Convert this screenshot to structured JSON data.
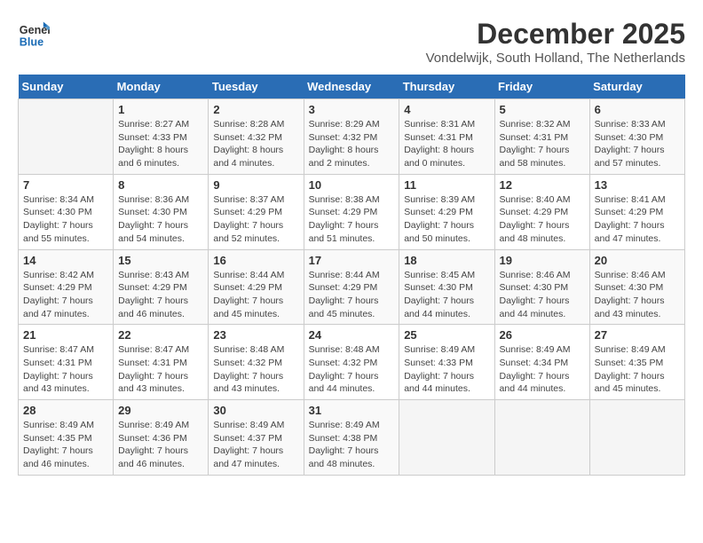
{
  "header": {
    "logo_line1": "General",
    "logo_line2": "Blue",
    "title": "December 2025",
    "subtitle": "Vondelwijk, South Holland, The Netherlands"
  },
  "calendar": {
    "weekdays": [
      "Sunday",
      "Monday",
      "Tuesday",
      "Wednesday",
      "Thursday",
      "Friday",
      "Saturday"
    ],
    "weeks": [
      [
        {
          "day": "",
          "info": ""
        },
        {
          "day": "1",
          "info": "Sunrise: 8:27 AM\nSunset: 4:33 PM\nDaylight: 8 hours\nand 6 minutes."
        },
        {
          "day": "2",
          "info": "Sunrise: 8:28 AM\nSunset: 4:32 PM\nDaylight: 8 hours\nand 4 minutes."
        },
        {
          "day": "3",
          "info": "Sunrise: 8:29 AM\nSunset: 4:32 PM\nDaylight: 8 hours\nand 2 minutes."
        },
        {
          "day": "4",
          "info": "Sunrise: 8:31 AM\nSunset: 4:31 PM\nDaylight: 8 hours\nand 0 minutes."
        },
        {
          "day": "5",
          "info": "Sunrise: 8:32 AM\nSunset: 4:31 PM\nDaylight: 7 hours\nand 58 minutes."
        },
        {
          "day": "6",
          "info": "Sunrise: 8:33 AM\nSunset: 4:30 PM\nDaylight: 7 hours\nand 57 minutes."
        }
      ],
      [
        {
          "day": "7",
          "info": "Sunrise: 8:34 AM\nSunset: 4:30 PM\nDaylight: 7 hours\nand 55 minutes."
        },
        {
          "day": "8",
          "info": "Sunrise: 8:36 AM\nSunset: 4:30 PM\nDaylight: 7 hours\nand 54 minutes."
        },
        {
          "day": "9",
          "info": "Sunrise: 8:37 AM\nSunset: 4:29 PM\nDaylight: 7 hours\nand 52 minutes."
        },
        {
          "day": "10",
          "info": "Sunrise: 8:38 AM\nSunset: 4:29 PM\nDaylight: 7 hours\nand 51 minutes."
        },
        {
          "day": "11",
          "info": "Sunrise: 8:39 AM\nSunset: 4:29 PM\nDaylight: 7 hours\nand 50 minutes."
        },
        {
          "day": "12",
          "info": "Sunrise: 8:40 AM\nSunset: 4:29 PM\nDaylight: 7 hours\nand 48 minutes."
        },
        {
          "day": "13",
          "info": "Sunrise: 8:41 AM\nSunset: 4:29 PM\nDaylight: 7 hours\nand 47 minutes."
        }
      ],
      [
        {
          "day": "14",
          "info": "Sunrise: 8:42 AM\nSunset: 4:29 PM\nDaylight: 7 hours\nand 47 minutes."
        },
        {
          "day": "15",
          "info": "Sunrise: 8:43 AM\nSunset: 4:29 PM\nDaylight: 7 hours\nand 46 minutes."
        },
        {
          "day": "16",
          "info": "Sunrise: 8:44 AM\nSunset: 4:29 PM\nDaylight: 7 hours\nand 45 minutes."
        },
        {
          "day": "17",
          "info": "Sunrise: 8:44 AM\nSunset: 4:29 PM\nDaylight: 7 hours\nand 45 minutes."
        },
        {
          "day": "18",
          "info": "Sunrise: 8:45 AM\nSunset: 4:30 PM\nDaylight: 7 hours\nand 44 minutes."
        },
        {
          "day": "19",
          "info": "Sunrise: 8:46 AM\nSunset: 4:30 PM\nDaylight: 7 hours\nand 44 minutes."
        },
        {
          "day": "20",
          "info": "Sunrise: 8:46 AM\nSunset: 4:30 PM\nDaylight: 7 hours\nand 43 minutes."
        }
      ],
      [
        {
          "day": "21",
          "info": "Sunrise: 8:47 AM\nSunset: 4:31 PM\nDaylight: 7 hours\nand 43 minutes."
        },
        {
          "day": "22",
          "info": "Sunrise: 8:47 AM\nSunset: 4:31 PM\nDaylight: 7 hours\nand 43 minutes."
        },
        {
          "day": "23",
          "info": "Sunrise: 8:48 AM\nSunset: 4:32 PM\nDaylight: 7 hours\nand 43 minutes."
        },
        {
          "day": "24",
          "info": "Sunrise: 8:48 AM\nSunset: 4:32 PM\nDaylight: 7 hours\nand 44 minutes."
        },
        {
          "day": "25",
          "info": "Sunrise: 8:49 AM\nSunset: 4:33 PM\nDaylight: 7 hours\nand 44 minutes."
        },
        {
          "day": "26",
          "info": "Sunrise: 8:49 AM\nSunset: 4:34 PM\nDaylight: 7 hours\nand 44 minutes."
        },
        {
          "day": "27",
          "info": "Sunrise: 8:49 AM\nSunset: 4:35 PM\nDaylight: 7 hours\nand 45 minutes."
        }
      ],
      [
        {
          "day": "28",
          "info": "Sunrise: 8:49 AM\nSunset: 4:35 PM\nDaylight: 7 hours\nand 46 minutes."
        },
        {
          "day": "29",
          "info": "Sunrise: 8:49 AM\nSunset: 4:36 PM\nDaylight: 7 hours\nand 46 minutes."
        },
        {
          "day": "30",
          "info": "Sunrise: 8:49 AM\nSunset: 4:37 PM\nDaylight: 7 hours\nand 47 minutes."
        },
        {
          "day": "31",
          "info": "Sunrise: 8:49 AM\nSunset: 4:38 PM\nDaylight: 7 hours\nand 48 minutes."
        },
        {
          "day": "",
          "info": ""
        },
        {
          "day": "",
          "info": ""
        },
        {
          "day": "",
          "info": ""
        }
      ]
    ]
  }
}
